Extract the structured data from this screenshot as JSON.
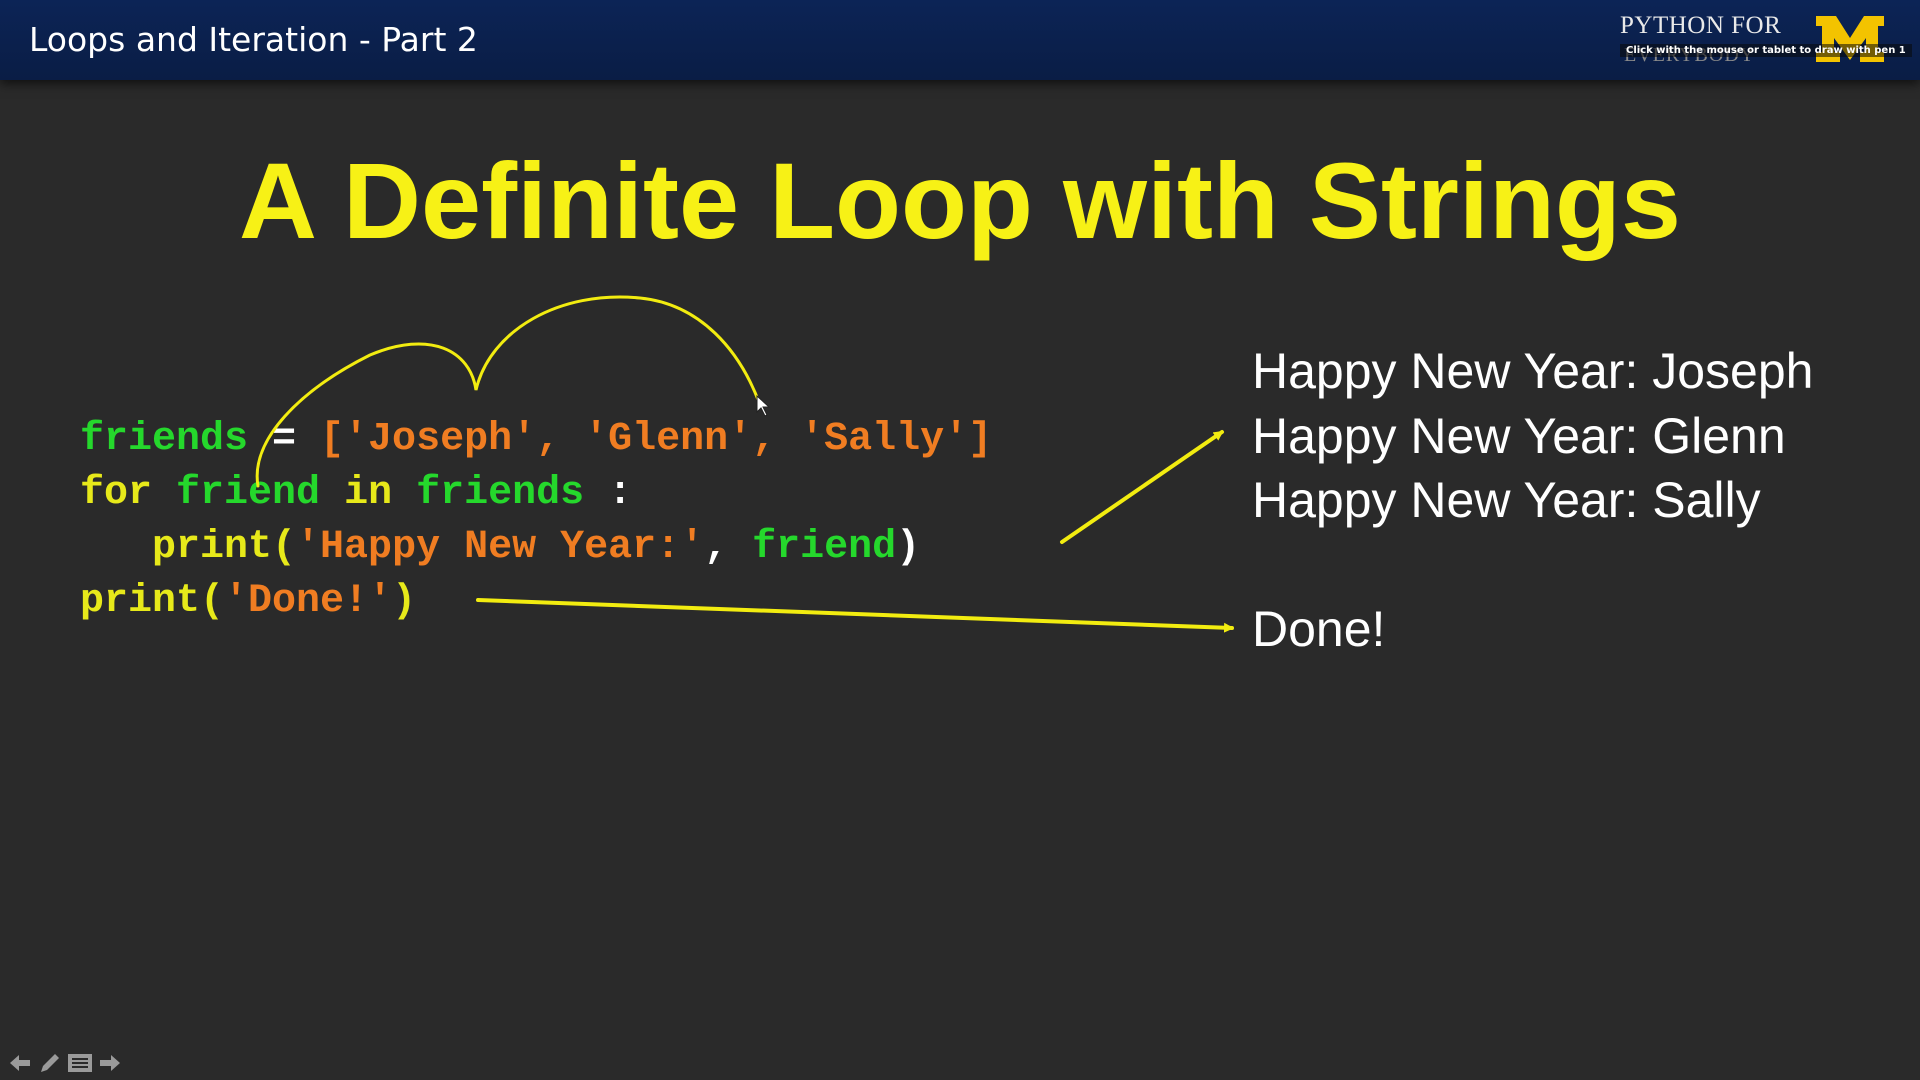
{
  "header": {
    "title": "Loops and Iteration - Part 2",
    "brand_text": "PYTHON FOR",
    "brand_subtext": "EVERYBODY",
    "logo_letter": "M",
    "hint": "Click with the mouse or tablet to draw with pen 1"
  },
  "slide": {
    "title": "A Definite Loop with Strings"
  },
  "code": {
    "line1": {
      "var": "friends",
      "op": " = ",
      "list": "['Joseph', 'Glenn', 'Sally']"
    },
    "line2": {
      "kw_for": "for",
      "var_friend": "friend",
      "kw_in": "in",
      "var_friends": "friends",
      "colon": " :"
    },
    "line3": {
      "indent": "   ",
      "fn": "print(",
      "str": "'Happy New Year:'",
      "comma": ", ",
      "var": "friend",
      "close": ")"
    },
    "line4": {
      "fn": "print(",
      "str": "'Done!'",
      "close": ")"
    }
  },
  "output": {
    "lines": [
      "Happy New Year: Joseph",
      "Happy New Year: Glenn",
      "Happy New Year: Sally"
    ],
    "done": "Done!"
  },
  "navigation": {
    "icons": [
      "arrow-left-icon",
      "pen-icon",
      "menu-icon",
      "arrow-right-icon"
    ]
  },
  "colors": {
    "background": "#2a2a2a",
    "header_bar": "#0c2456",
    "title_yellow": "#f7f116",
    "keyword_yellow": "#e7e91a",
    "variable_green": "#25d82c",
    "string_orange": "#f07d22",
    "annotation_yellow": "#f2ec10",
    "logo_maize": "#f3c300"
  }
}
